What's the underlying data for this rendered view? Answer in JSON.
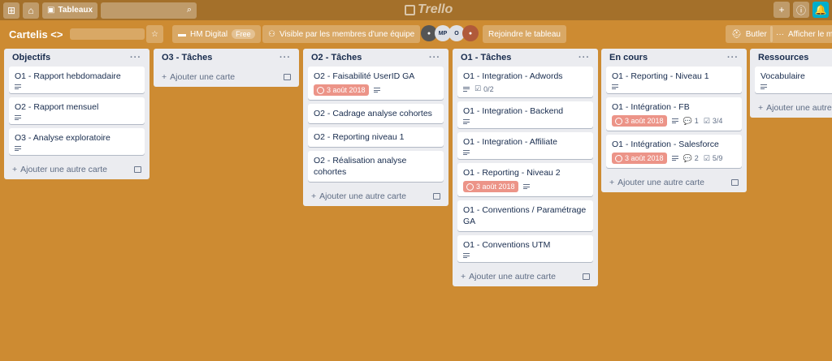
{
  "topbar": {
    "grid_icon": "grid-icon",
    "home_icon": "home-icon",
    "boards_label": "Tableaux",
    "search_icon": "search-icon",
    "logo": "Trello",
    "add_icon": "plus-icon",
    "info_icon": "info-icon",
    "bell_icon": "bell-icon"
  },
  "board": {
    "name": "Cartelis <>",
    "star_icon": "star-icon",
    "team": "HM Digital",
    "team_badge": "Free",
    "visibility": "Visible par les membres d'une équipe",
    "members": [
      "MP",
      "O"
    ],
    "join": "Rejoindre le tableau",
    "butler": "Butler",
    "show_menu": "Afficher le menu"
  },
  "add_card_label": "Ajouter une carte",
  "add_other_card_label": "Ajouter une autre carte",
  "lists": [
    {
      "title": "Objectifs",
      "cards": [
        {
          "title": "O1 - Rapport hebdomadaire"
        },
        {
          "title": "O2 - Rapport mensuel"
        },
        {
          "title": "O3 - Analyse exploratoire"
        }
      ]
    },
    {
      "title": "O3 - Tâches",
      "cards": []
    },
    {
      "title": "O2 - Tâches",
      "cards": [
        {
          "title": "O2 - Faisabilité UserID GA",
          "due": "3 août 2018"
        },
        {
          "title": "O2 - Cadrage analyse cohortes"
        },
        {
          "title": "O2 - Reporting niveau 1"
        },
        {
          "title": "O2 - Réalisation analyse cohortes"
        }
      ]
    },
    {
      "title": "O1 - Tâches",
      "cards": [
        {
          "title": "O1 - Integration - Adwords",
          "checklist": "0/2"
        },
        {
          "title": "O1 - Integration - Backend"
        },
        {
          "title": "O1 - Integration - Affiliate"
        },
        {
          "title": "O1 - Reporting - Niveau 2",
          "due": "3 août 2018"
        },
        {
          "title": "O1 - Conventions / Paramétrage GA"
        },
        {
          "title": "O1 - Conventions UTM"
        }
      ]
    },
    {
      "title": "En cours",
      "cards": [
        {
          "title": "O1 - Reporting - Niveau 1"
        },
        {
          "title": "O1 - Intégration - FB",
          "due": "3 août 2018",
          "comments": "1",
          "checklist": "3/4"
        },
        {
          "title": "O1 - Intégration - Salesforce",
          "due": "3 août 2018",
          "comments": "2",
          "checklist": "5/9"
        }
      ]
    },
    {
      "title": "Ressources",
      "cards": [
        {
          "title": "Vocabulaire"
        }
      ]
    }
  ]
}
